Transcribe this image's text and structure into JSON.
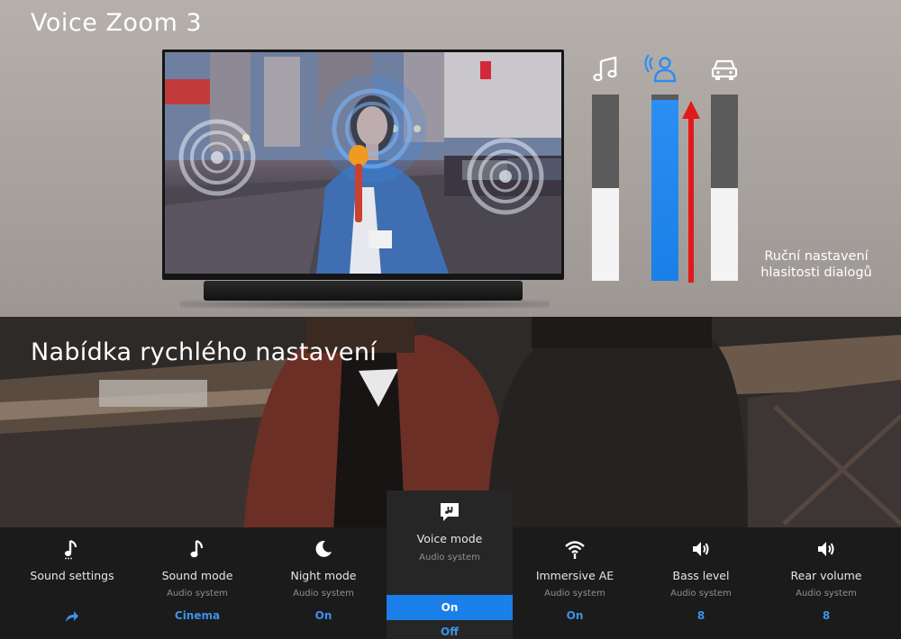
{
  "top": {
    "title": "Voice Zoom 3",
    "dialog_caption_line1": "Ruční nastavení",
    "dialog_caption_line2": "hlasitosti dialogů",
    "levels": [
      {
        "name": "music",
        "icon": "music-note-icon",
        "fill": 0.5
      },
      {
        "name": "voice",
        "icon": "voice-person-icon",
        "fill": 0.97
      },
      {
        "name": "car",
        "icon": "car-icon",
        "fill": 0.5
      }
    ],
    "colors": {
      "voice_bar": "#1a7fe8",
      "arrow": "#e01a1a",
      "bar_bg": "#5b5b5b",
      "bar_fill": "#f4f4f4"
    }
  },
  "bottom": {
    "title": "Nabídka rychlého nastavení",
    "menu": [
      {
        "id": "sound-settings",
        "label": "Sound settings",
        "sub": "",
        "value": "",
        "icon": "music-note-icon",
        "value_icon": "arrow-forward-icon"
      },
      {
        "id": "sound-mode",
        "label": "Sound mode",
        "sub": "Audio system",
        "value": "Cinema",
        "icon": "music-note-icon"
      },
      {
        "id": "night-mode",
        "label": "Night mode",
        "sub": "Audio system",
        "value": "On",
        "icon": "moon-icon"
      },
      {
        "id": "voice-mode",
        "label": "Voice mode",
        "sub": "Audio system",
        "icon": "speech-bubble-icon",
        "options": [
          "On",
          "Off"
        ],
        "selected": "On"
      },
      {
        "id": "immersive-ae",
        "label": "Immersive AE",
        "sub": "Audio system",
        "value": "On",
        "icon": "wifi-signal-icon"
      },
      {
        "id": "bass-level",
        "label": "Bass level",
        "sub": "Audio system",
        "value": "8",
        "icon": "speaker-icon"
      },
      {
        "id": "rear-volume",
        "label": "Rear volume",
        "sub": "Audio system",
        "value": "8",
        "icon": "speaker-icon"
      }
    ],
    "colors": {
      "accent": "#3d92ea",
      "selected_bg": "#1a7fe8",
      "menu_bg": "#1b1b1b",
      "card_bg": "#262626"
    }
  }
}
